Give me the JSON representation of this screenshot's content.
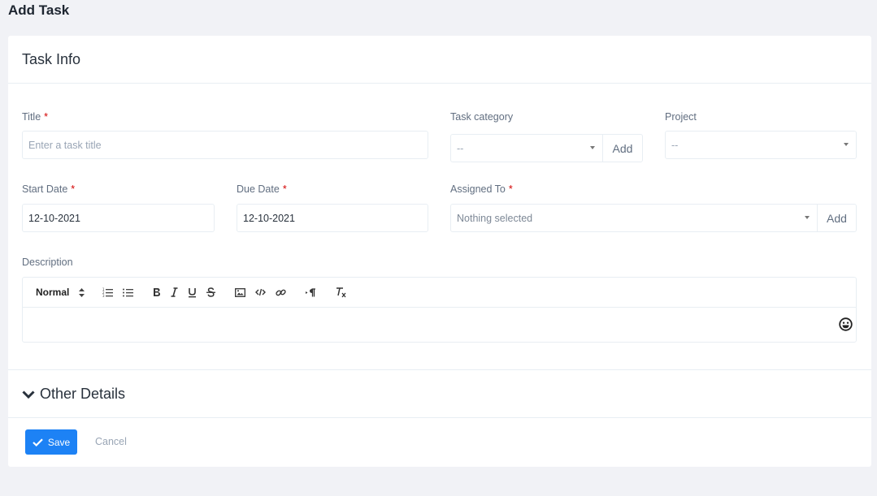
{
  "page": {
    "title": "Add Task"
  },
  "card": {
    "header": "Task Info"
  },
  "form": {
    "title": {
      "label": "Title",
      "required_mark": "*",
      "placeholder": "Enter a task title"
    },
    "task_category": {
      "label": "Task category",
      "value": "--",
      "add_label": "Add"
    },
    "project": {
      "label": "Project",
      "value": "--"
    },
    "start_date": {
      "label": "Start Date",
      "required_mark": "*",
      "value": "12-10-2021"
    },
    "due_date": {
      "label": "Due Date",
      "required_mark": "*",
      "value": "12-10-2021"
    },
    "assigned_to": {
      "label": "Assigned To",
      "required_mark": "*",
      "value": "Nothing selected",
      "add_label": "Add"
    },
    "description": {
      "label": "Description",
      "toolbar": {
        "header_select": "Normal"
      }
    }
  },
  "other_details": {
    "label": "Other Details"
  },
  "actions": {
    "save_label": "Save",
    "cancel_label": "Cancel"
  },
  "colors": {
    "primary": "#1d82f5",
    "required": "#d30000",
    "muted": "#99a5b5",
    "label": "#616e80"
  },
  "icons": [
    "ordered-list-icon",
    "bullet-list-icon",
    "bold-icon",
    "italic-icon",
    "underline-icon",
    "strike-icon",
    "image-icon",
    "code-icon",
    "link-icon",
    "rtl-paragraph-icon",
    "clear-format-icon",
    "emoji-icon",
    "chevron-down-icon",
    "check-icon"
  ]
}
